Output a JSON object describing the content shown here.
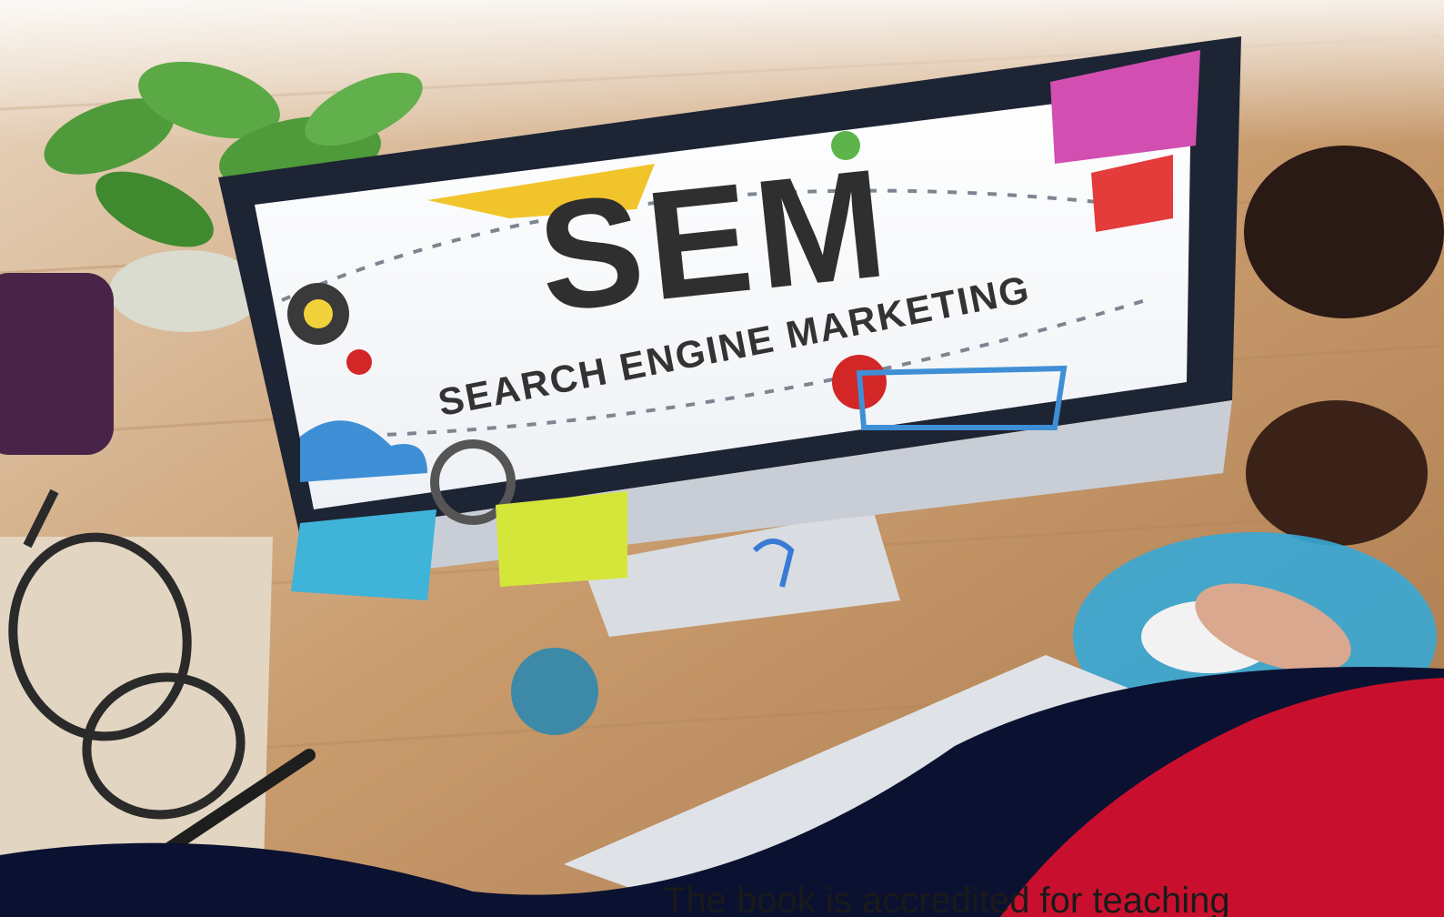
{
  "screen": {
    "title": "SEM",
    "subtitle": "SEARCH ENGINE MARKETING"
  },
  "banner": {
    "caption": "The book is accredited for teaching"
  },
  "colors": {
    "banner_navy": "#0b1130",
    "banner_red": "#c8102e",
    "desk": "#c9a27a"
  }
}
